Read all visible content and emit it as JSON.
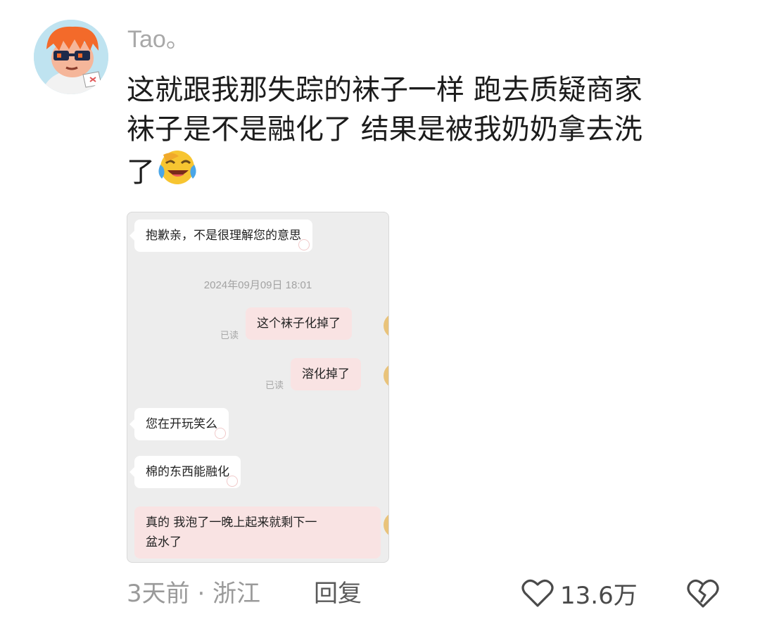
{
  "comment": {
    "username": "Tao。",
    "text_lines": [
      "这就跟我那失踪的袜子一样 跑去质疑商家",
      "袜子是不是融化了 结果是被我奶奶拿去洗",
      "了"
    ],
    "emoji": "laughing-crying-emoji",
    "time_location": "3天前 · 浙江",
    "reply_label": "回复",
    "like_count": "13.6万",
    "icons": {
      "like": "heart-outline-icon",
      "dislike": "broken-heart-icon"
    }
  },
  "chat_screenshot": {
    "messages": [
      {
        "side": "left",
        "text": "抱歉亲，不是很理解您的意思"
      },
      {
        "side": "center",
        "text": "2024年09月09日 18:01"
      },
      {
        "side": "right",
        "text": "这个袜子化掉了",
        "status": "已读"
      },
      {
        "side": "right",
        "text": "溶化掉了",
        "status": "已读"
      },
      {
        "side": "left",
        "text": "您在开玩笑么"
      },
      {
        "side": "left",
        "text": "棉的东西能融化"
      },
      {
        "side": "right",
        "text_lines": [
          "真的 我泡了一晚上起来就剩下一",
          "盆水了"
        ]
      }
    ]
  },
  "colors": {
    "username": "#a8a8a8",
    "text": "#1c1c1c",
    "right_bubble": "#f9e3e3",
    "chat_bg": "#ededed"
  }
}
